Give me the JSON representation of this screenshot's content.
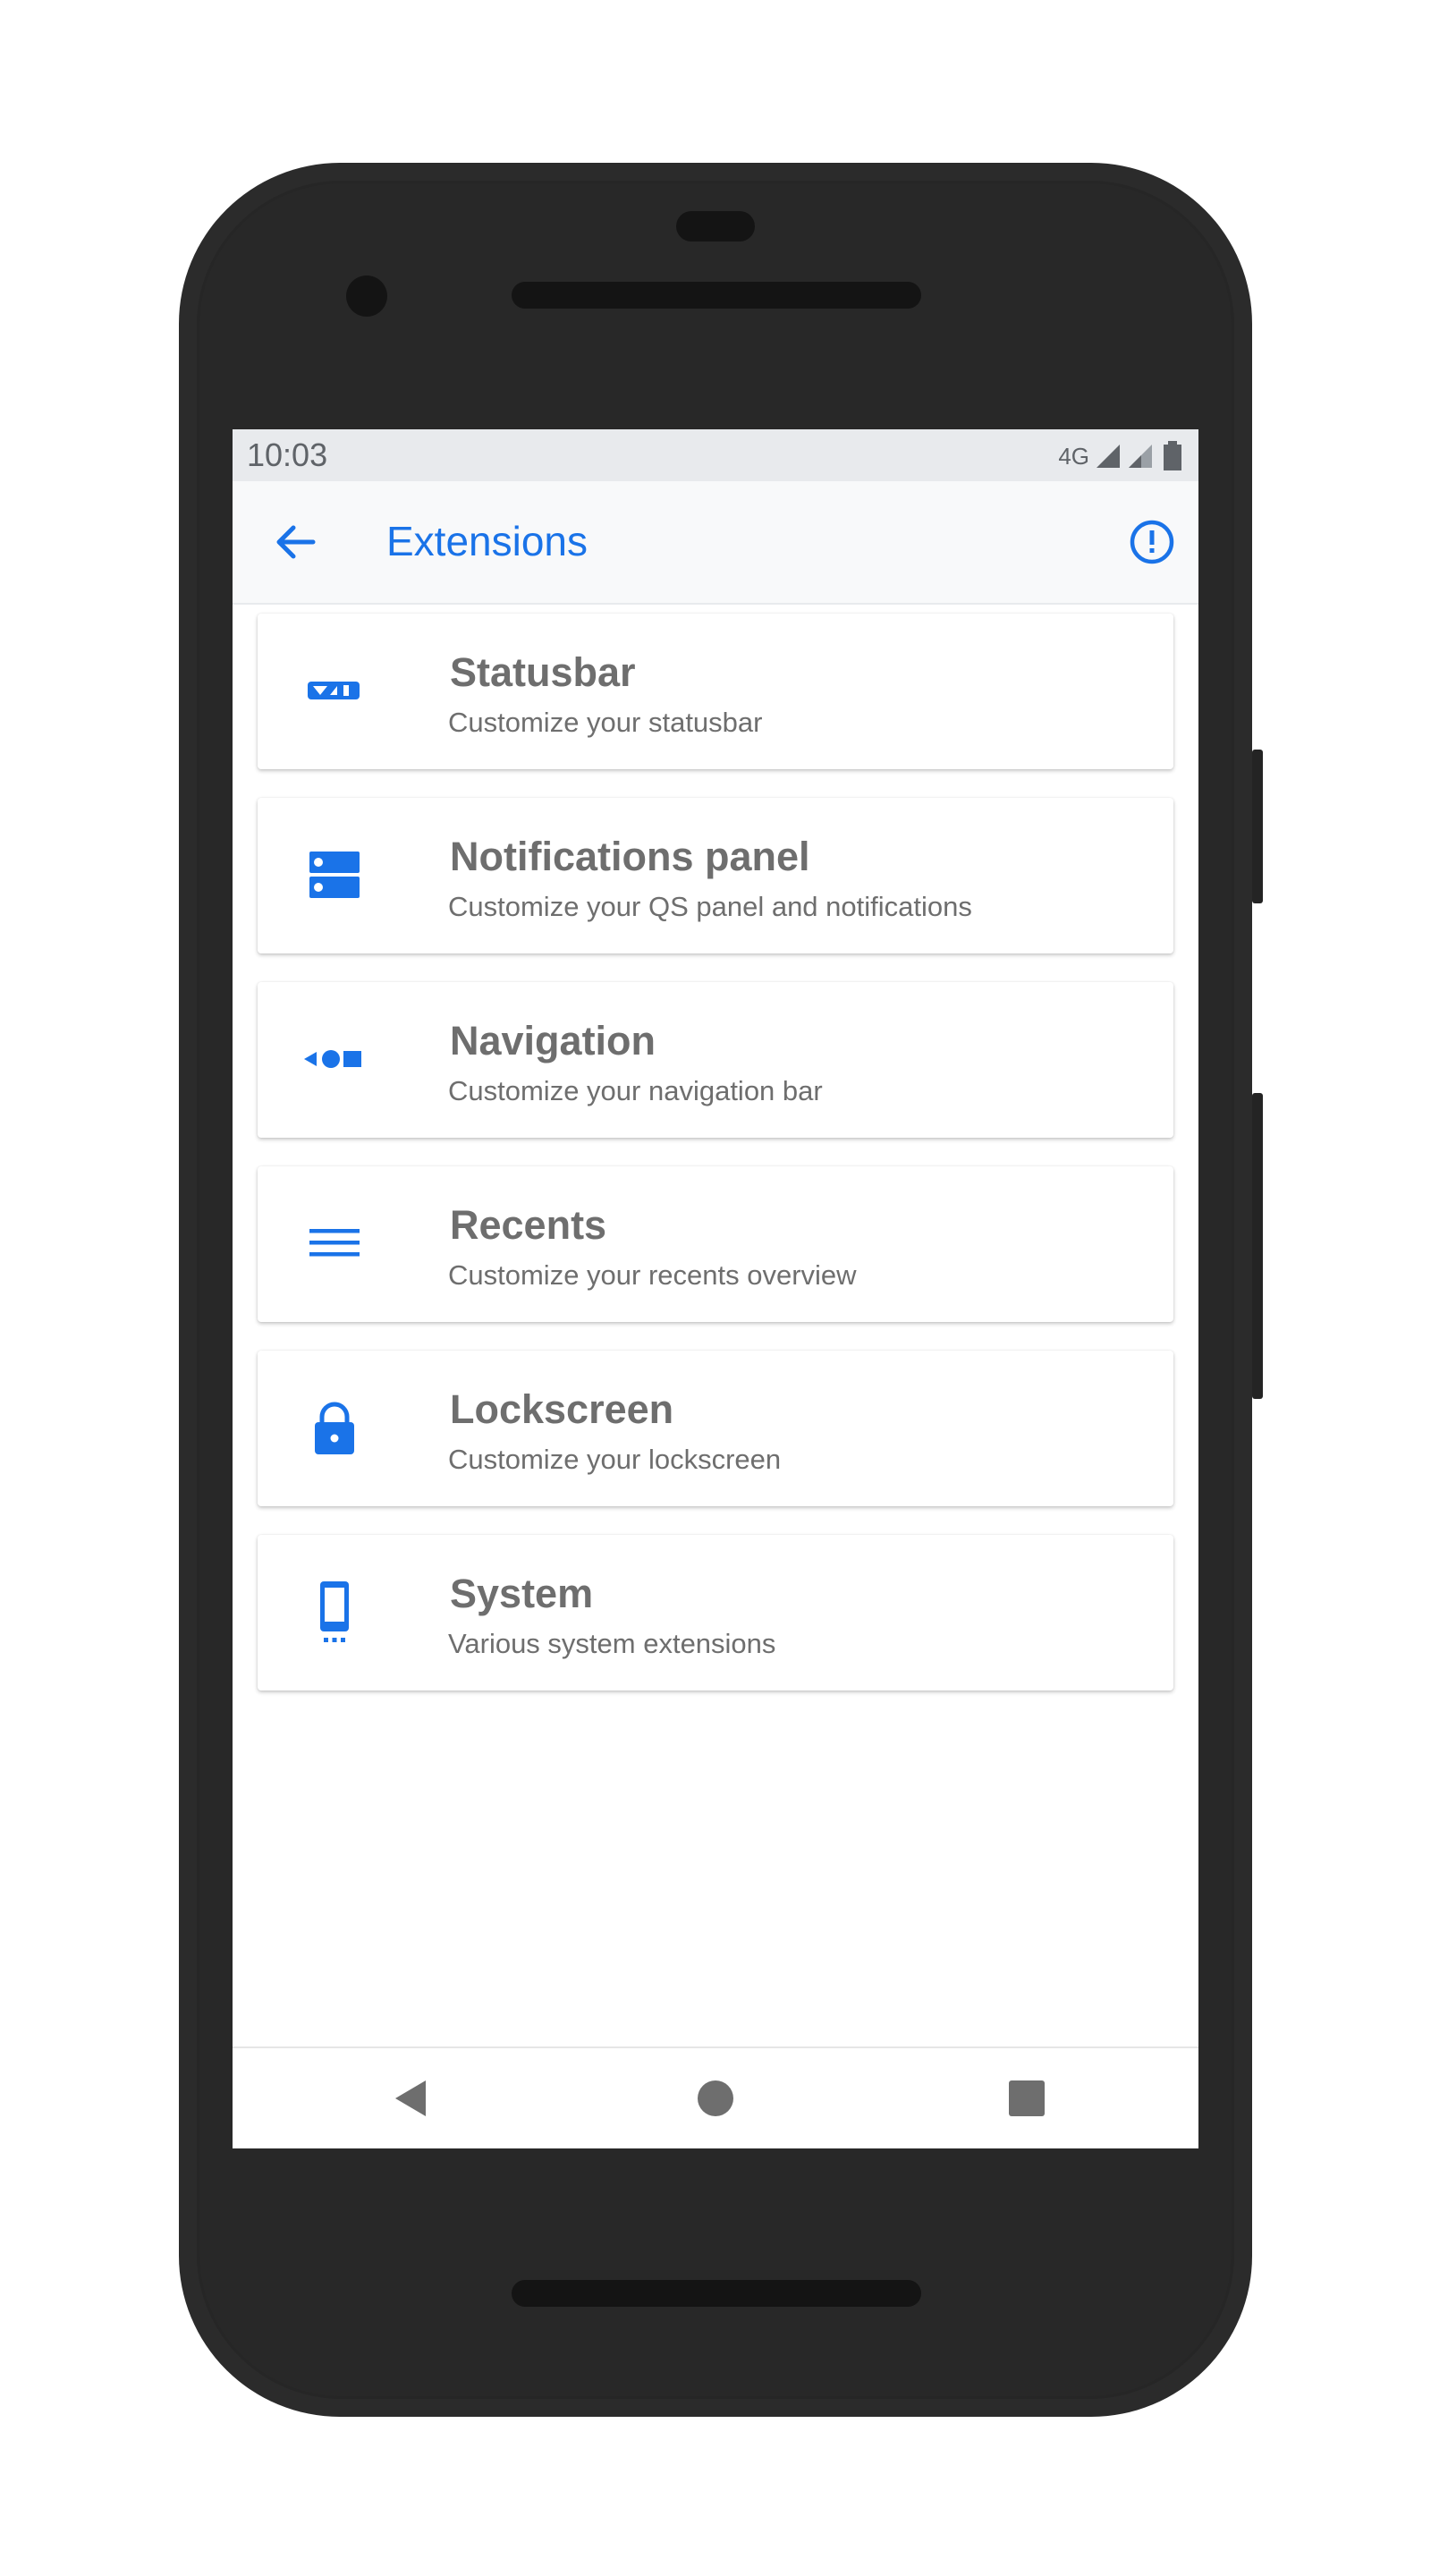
{
  "status": {
    "time": "10:03",
    "network": "4G"
  },
  "toolbar": {
    "title": "Extensions",
    "back_icon": "arrow-back-icon",
    "info_icon": "info-outline-icon"
  },
  "items": [
    {
      "title": "Statusbar",
      "subtitle": "Customize your statusbar",
      "icon": "statusbar-icon"
    },
    {
      "title": "Notifications panel",
      "subtitle": "Customize your QS panel and notifications",
      "icon": "notifications-panel-icon"
    },
    {
      "title": "Navigation",
      "subtitle": "Customize your navigation bar",
      "icon": "navigation-icon"
    },
    {
      "title": "Recents",
      "subtitle": "Customize your recents overview",
      "icon": "recents-icon"
    },
    {
      "title": "Lockscreen",
      "subtitle": "Customize your lockscreen",
      "icon": "lock-icon"
    },
    {
      "title": "System",
      "subtitle": "Various system extensions",
      "icon": "phone-icon"
    }
  ],
  "navbar": {
    "back_icon": "nav-back-icon",
    "home_icon": "nav-home-icon",
    "recents_icon": "nav-recents-icon"
  },
  "colors": {
    "accent": "#1a73e8",
    "text_secondary": "#6e6e6e",
    "phone_body": "#2b2b2b"
  }
}
